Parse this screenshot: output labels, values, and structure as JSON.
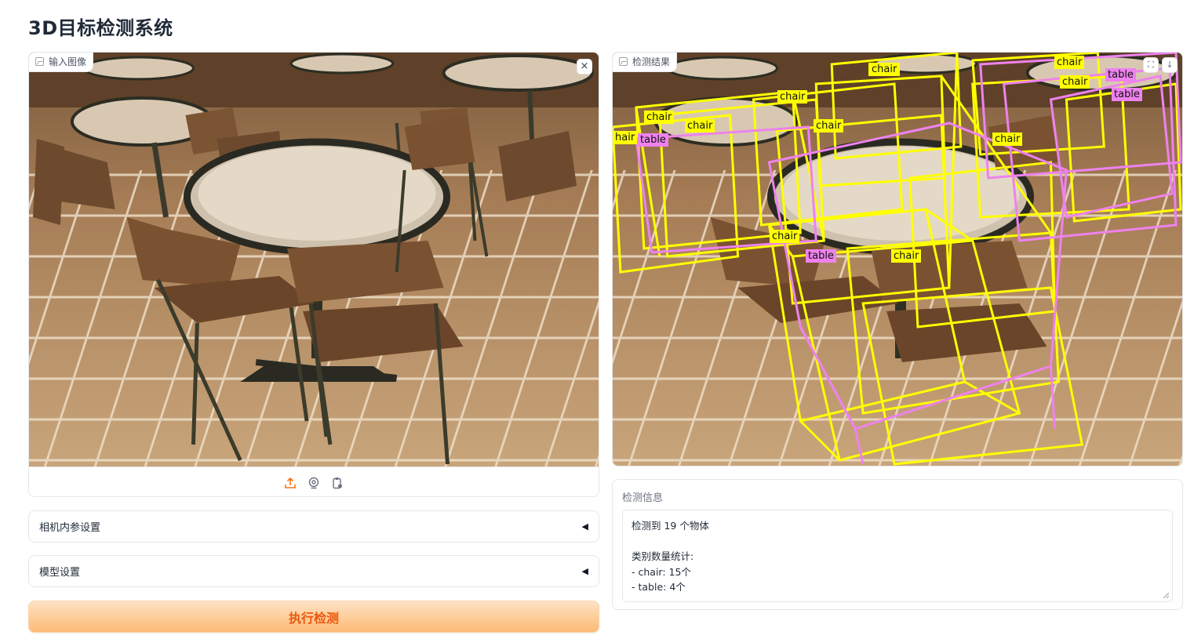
{
  "app": {
    "title": "3D目标检测系统"
  },
  "input_panel": {
    "label": "输入图像",
    "close_glyph": "×"
  },
  "source_bar": {
    "icons": [
      "upload-icon",
      "webcam-icon",
      "clipboard-icon"
    ]
  },
  "output_panel": {
    "label": "检测结果",
    "fullscreen_glyph": "⛶",
    "download_glyph": "↓"
  },
  "detection_labels": {
    "chair": "chair",
    "table": "table",
    "chair_partial": "hair",
    "box_colors": {
      "chair": "#ffff00",
      "table": "#ee82ee"
    }
  },
  "accordions": {
    "camera": {
      "label": "相机内参设置",
      "arrow": "◀"
    },
    "model": {
      "label": "模型设置",
      "arrow": "◀"
    }
  },
  "run_button": {
    "label": "执行检测"
  },
  "info": {
    "label": "检测信息",
    "text": "检测到 19 个物体\n\n类别数量统计:\n- chair: 15个\n- table: 4个"
  },
  "colors": {
    "accent": "#f97316",
    "button_text": "#ea580c"
  }
}
